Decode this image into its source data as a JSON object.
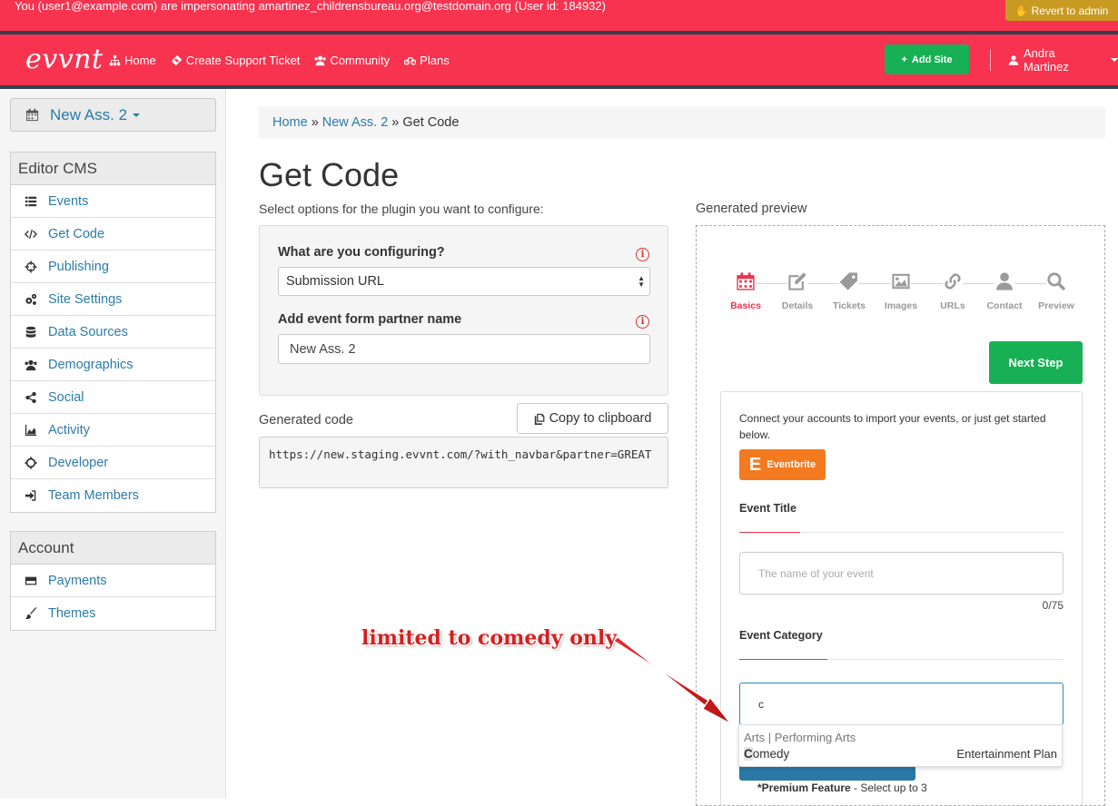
{
  "impersonation": {
    "text": "You (user1@example.com) are impersonating amartinez_childrensbureau.org@testdomain.org (User id: 184932)",
    "revert_label": "Revert to admin"
  },
  "navbar": {
    "logo": "evvnt",
    "items": [
      {
        "label": "Home",
        "icon": "sitemap-icon"
      },
      {
        "label": "Create Support Ticket",
        "icon": "ticket-icon"
      },
      {
        "label": "Community",
        "icon": "users-icon"
      },
      {
        "label": "Plans",
        "icon": "bicycle-icon"
      }
    ],
    "add_site_label": "Add Site",
    "user_name": "Andra Martinez"
  },
  "sidebar": {
    "site_name": "New Ass. 2",
    "editor_heading": "Editor CMS",
    "editor_items": [
      {
        "label": "Events",
        "icon": "list-icon"
      },
      {
        "label": "Get Code",
        "icon": "code-icon"
      },
      {
        "label": "Publishing",
        "icon": "crosshairs-icon"
      },
      {
        "label": "Site Settings",
        "icon": "cogs-icon"
      },
      {
        "label": "Data Sources",
        "icon": "database-icon"
      },
      {
        "label": "Demographics",
        "icon": "users-icon"
      },
      {
        "label": "Social",
        "icon": "share-icon"
      },
      {
        "label": "Activity",
        "icon": "area-chart-icon"
      },
      {
        "label": "Developer",
        "icon": "gear-icon"
      },
      {
        "label": "Team Members",
        "icon": "sign-in-icon"
      }
    ],
    "account_heading": "Account",
    "account_items": [
      {
        "label": "Payments",
        "icon": "credit-card-icon"
      },
      {
        "label": "Themes",
        "icon": "paint-brush-icon"
      }
    ]
  },
  "breadcrumb": {
    "home": "Home",
    "site": "New Ass. 2",
    "current": "Get Code",
    "separator": "»"
  },
  "main": {
    "title": "Get Code",
    "subtitle": "Select options for the plugin you want to configure:",
    "configuring_label": "What are you configuring?",
    "configuring_value": "Submission URL",
    "partner_label": "Add event form partner name",
    "partner_value": "New Ass. 2",
    "generated_code_label": "Generated code",
    "copy_label": "Copy to clipboard",
    "generated_code": "https://new.staging.evvnt.com/?with_navbar&partner=GREAT"
  },
  "preview": {
    "label": "Generated preview",
    "steps": [
      "Basics",
      "Details",
      "Tickets",
      "Images",
      "URLs",
      "Contact",
      "Preview"
    ],
    "next_step_label": "Next Step",
    "connect_text": "Connect your accounts to import your events, or just get started below.",
    "eventbrite_label": "Eventbrite",
    "event_title_heading": "Event Title",
    "event_title_placeholder": "The name of your event",
    "char_count": "0/75",
    "event_category_heading": "Event Category",
    "category_query": "c",
    "autocomplete_group": "Arts | Performing Arts",
    "autocomplete_match": "C",
    "autocomplete_rest": "omedy",
    "autocomplete_plan": "Entertainment Plan",
    "premium_bold": "*Premium Feature",
    "premium_rest": " - Select up to 3"
  },
  "annotation": {
    "text": "limited to comedy only",
    "color": "#d42020"
  },
  "colors": {
    "brand_red": "#f7334f",
    "dark_bar": "#34404f",
    "green": "#17b054",
    "link_blue": "#2c7ba8",
    "revert_gold": "#c79a22"
  }
}
